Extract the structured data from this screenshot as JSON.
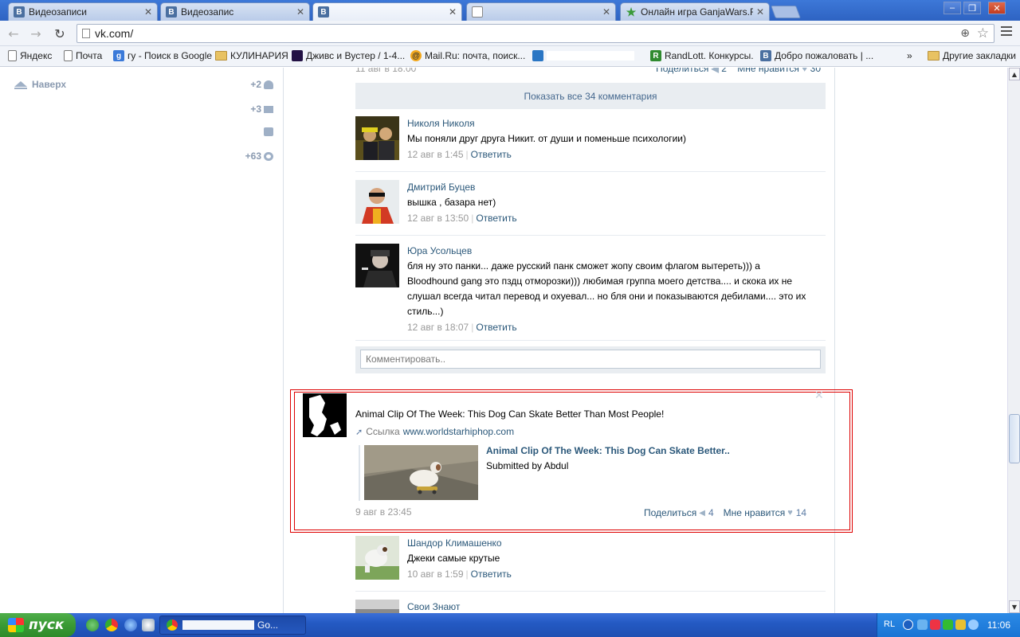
{
  "browser": {
    "tabs": [
      {
        "icon": "B",
        "title": "Видеозаписи"
      },
      {
        "icon": "B",
        "title": "Видеозапис"
      },
      {
        "icon": "B",
        "title": ""
      },
      {
        "icon": "",
        "title": ""
      },
      {
        "icon": "★",
        "title": "Онлайн игра GanjaWars.Ru"
      }
    ],
    "tab_close": "✕",
    "window_controls": {
      "minimize": "‒",
      "restore": "❐",
      "close": "✕"
    },
    "nav": {
      "back": "←",
      "forward": "→",
      "reload": "↻"
    },
    "url": "vk.com/",
    "bookmarks": [
      {
        "label": "Яндекс",
        "icon": "page"
      },
      {
        "label": "Почта",
        "icon": "page"
      },
      {
        "label": "гу - Поиск в Google",
        "icon": "g",
        "glyph": "g"
      },
      {
        "label": "КУЛИНАРИЯ",
        "icon": "folder"
      },
      {
        "label": "Дживс и Вустер / 1-4...",
        "icon": "dark"
      },
      {
        "label": "Mail.Ru: почта, поиск...",
        "icon": "mail",
        "glyph": "@"
      },
      {
        "label": "",
        "icon": "bag"
      },
      {
        "label": "RandLott. Конкурсы.",
        "icon": "rl",
        "glyph": "R"
      },
      {
        "label": "Добро пожаловать | ...",
        "icon": "vk",
        "glyph": "B"
      }
    ],
    "bookmarks_overflow": "»",
    "other_bookmarks": "Другие закладки"
  },
  "sidebar": {
    "back_to_top": "Наверх",
    "counters": [
      {
        "value": "+2",
        "icon": "person-icon"
      },
      {
        "value": "+3",
        "icon": "envelope-icon"
      },
      {
        "value": "",
        "icon": "chat-bubble-icon"
      },
      {
        "value": "+63",
        "icon": "gear-icon"
      }
    ]
  },
  "feed": {
    "prev_post": {
      "date": "11 авг в 18:00",
      "share_label": "Поделиться",
      "share_count": "2",
      "like_label": "Мне нравится",
      "like_count": "30"
    },
    "show_all_comments": "Показать все 34 комментария",
    "comments": [
      {
        "author": "Николя Николя",
        "lines": [
          "Мы поняли друг друга Никит. от души и поменьше психологии)"
        ],
        "time": "12 авг в 1:45",
        "reply": "Ответить"
      },
      {
        "author": "Дмитрий Буцев",
        "lines": [
          "вышка , базара нет)"
        ],
        "time": "12 авг в 13:50",
        "reply": "Ответить"
      },
      {
        "author": "Юра Усольцев",
        "lines": [
          "бля ну это панки... даже русский панк сможет жопу своим флагом вытереть))) а",
          "Bloodhound gang это пздц отморозки))) любимая группа моего детства.... и скока их не",
          "слушал всегда читал перевод и охуевал... но бля они и показываются дебилами.... это их",
          "стиль...)"
        ],
        "time": "12 авг в 18:07",
        "reply": "Ответить"
      }
    ],
    "reply_placeholder": "Комментировать..",
    "post": {
      "author": "",
      "text": "Animal Clip Of The Week: This Dog Can Skate Better Than Most People!",
      "link_label": "Ссылка",
      "link_domain": "www.worldstarhiphop.com",
      "attach_title": "Animal Clip Of The Week: This Dog Can Skate Better..",
      "attach_sub": "Submitted by Abdul",
      "date": "9 авг в 23:45",
      "share_label": "Поделиться",
      "share_count": "4",
      "like_label": "Мне нравится",
      "like_count": "14",
      "close": "✕"
    },
    "post_comments": [
      {
        "author": "Шандор Климашенко",
        "lines": [
          "Джеки самые крутые"
        ],
        "time": "10 авг в 1:59",
        "reply": "Ответить"
      },
      {
        "author": "Свои Знают",
        "lines": [],
        "time": "",
        "reply": ""
      }
    ]
  },
  "taskbar": {
    "start_label": "пуск",
    "task_label": "Go...",
    "lang": "RL",
    "clock": "11:06"
  }
}
